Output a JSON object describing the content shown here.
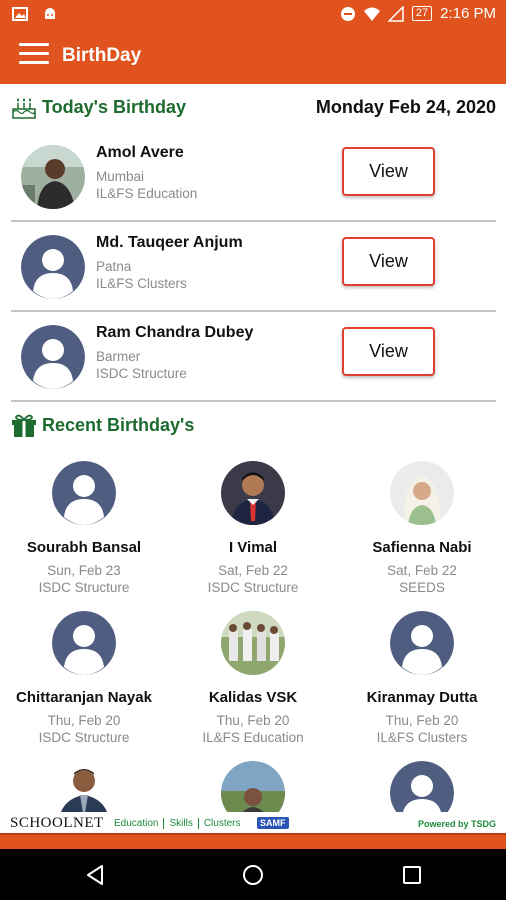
{
  "status_bar": {
    "time": "2:16 PM",
    "battery": "27"
  },
  "app_bar": {
    "title": "BirthDay"
  },
  "today": {
    "label": "Today's Birthday",
    "date": "Monday Feb 24, 2020",
    "people": [
      {
        "name": "Amol Avere",
        "city": "Mumbai",
        "org": "IL&FS Education",
        "button": "View",
        "avatar": "photo"
      },
      {
        "name": "Md. Tauqeer Anjum",
        "city": "Patna",
        "org": "IL&FS Clusters",
        "button": "View",
        "avatar": "placeholder"
      },
      {
        "name": "Ram Chandra Dubey",
        "city": "Barmer",
        "org": "ISDC Structure",
        "button": "View",
        "avatar": "placeholder"
      }
    ]
  },
  "recent": {
    "label": "Recent Birthday's",
    "people": [
      {
        "name": "Sourabh Bansal",
        "date": "Sun, Feb 23",
        "org": "ISDC Structure",
        "avatar": "placeholder"
      },
      {
        "name": "I Vimal",
        "date": "Sat, Feb 22",
        "org": "ISDC Structure",
        "avatar": "photo"
      },
      {
        "name": "Safienna Nabi",
        "date": "Sat, Feb 22",
        "org": "SEEDS",
        "avatar": "photo"
      },
      {
        "name": "Chittaranjan Nayak",
        "date": "Thu, Feb 20",
        "org": "ISDC Structure",
        "avatar": "placeholder"
      },
      {
        "name": "Kalidas VSK",
        "date": "Thu, Feb 20",
        "org": "IL&FS Education",
        "avatar": "photo"
      },
      {
        "name": "Kiranmay Dutta",
        "date": "Thu, Feb 20",
        "org": "IL&FS Clusters",
        "avatar": "placeholder"
      },
      {
        "name": "",
        "date": "",
        "org": "",
        "avatar": "photo"
      },
      {
        "name": "",
        "date": "",
        "org": "",
        "avatar": "photo"
      },
      {
        "name": "",
        "date": "",
        "org": "",
        "avatar": "placeholder"
      }
    ]
  },
  "footer": {
    "brand": "SCHOOLNET",
    "links": [
      "Education",
      "Skills",
      "Clusters"
    ],
    "partner": "SAMF",
    "powered_by": "Powered by TSDG"
  },
  "icons": {
    "menu": "hamburger-icon",
    "cake": "cake-icon",
    "gift": "gift-icon",
    "nav": [
      "back-icon",
      "home-icon",
      "recents-icon"
    ]
  },
  "colors": {
    "primary": "#e0531f",
    "section_heading": "#1d6b2e",
    "button_border": "#e04030",
    "placeholder_avatar": "#4f5d80"
  }
}
